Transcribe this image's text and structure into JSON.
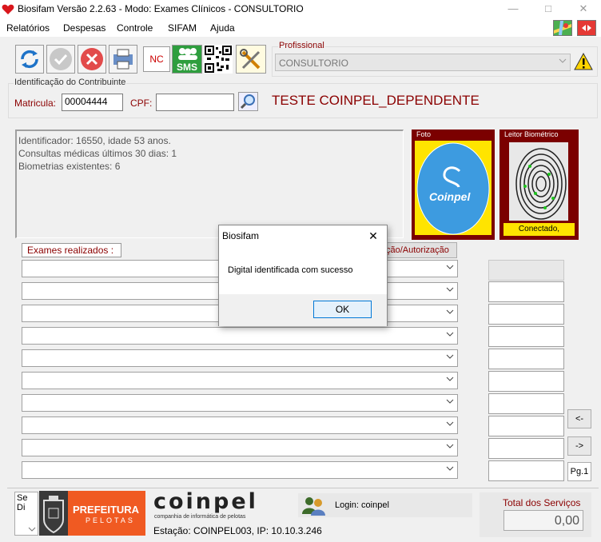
{
  "window": {
    "title": "Biosifam Versão 2.2.63 - Modo: Exames Clínicos - CONSULTORIO"
  },
  "menu": [
    "Relatórios",
    "Despesas",
    "Controle",
    "SIFAM",
    "Ajuda"
  ],
  "toolbar": {
    "nc_label": "NC",
    "sms_label": "SMS"
  },
  "profissional": {
    "label": "Profissional",
    "value": "CONSULTORIO"
  },
  "contribuinte": {
    "group_label": "Identificação do Contribuinte",
    "matricula_label": "Matricula:",
    "matricula_value": "00004444",
    "cpf_label": "CPF:",
    "cpf_value": "",
    "name": "TESTE COINPEL_DEPENDENTE"
  },
  "info": {
    "line1": "Identificador: 16550, idade 53 anos.",
    "line2": "Consultas médicas últimos 30 dias: 1",
    "line3": "Biometrias existentes: 6"
  },
  "foto": {
    "label": "Foto",
    "logo_text": "Coinpel"
  },
  "leitor": {
    "label": "Leitor Biométrico",
    "status": "Conectado,"
  },
  "exames": {
    "label": "Exames realizados :",
    "autorizacao_label": "ção/Autorização"
  },
  "nav": {
    "prev": "<-",
    "next": "->",
    "page": "Pg.1"
  },
  "footer": {
    "side_text_1": "Se",
    "side_text_2": "Di",
    "prefeitura_1": "PREFEITURA",
    "prefeitura_2": "PELOTAS",
    "coinpel_logo": "coinpel",
    "coinpel_sub": "companhia de informática de pelotas",
    "estacao": "Estação: COINPEL003, IP: 10.10.3.246",
    "login": "Login: coinpel",
    "total_label": "Total dos Serviços",
    "total_value": "0,00"
  },
  "dialog": {
    "title": "Biosifam",
    "message": "Digital identificada com sucesso",
    "ok": "OK"
  }
}
